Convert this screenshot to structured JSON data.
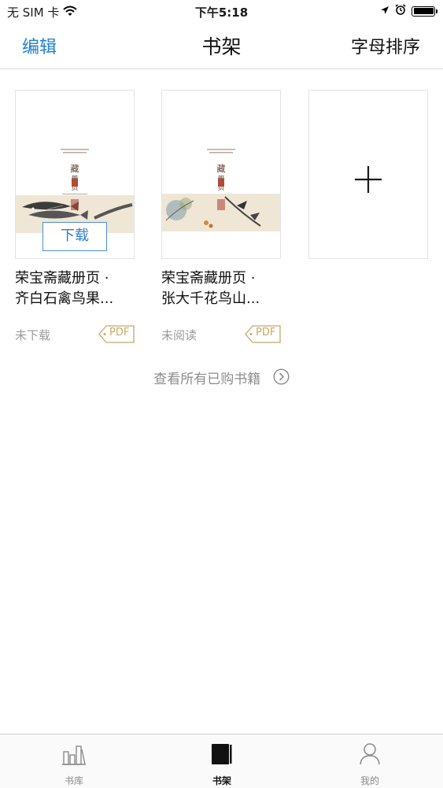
{
  "status_bar": {
    "carrier": "无 SIM 卡",
    "time": "下午5:18"
  },
  "nav": {
    "left_label": "编辑",
    "title": "书架",
    "right_label": "字母排序",
    "accent_color": "#1e7fd0"
  },
  "books": [
    {
      "title_line1": "荣宝斋藏册页 ·",
      "title_line2": "齐白石禽鸟果...",
      "status": "未下载",
      "badge": "PDF",
      "download_label": "下载"
    },
    {
      "title_line1": "荣宝斋藏册页 ·",
      "title_line2": "张大千花鸟山...",
      "status": "未阅读",
      "badge": "PDF"
    }
  ],
  "add_card": {
    "icon": "plus-icon"
  },
  "view_all": {
    "label": "查看所有已购书籍",
    "icon": "chevron-right-circle-icon"
  },
  "tabs": [
    {
      "label": "书库",
      "icon": "library-icon",
      "active": false
    },
    {
      "label": "书架",
      "icon": "bookshelf-icon",
      "active": true
    },
    {
      "label": "我的",
      "icon": "profile-icon",
      "active": false
    }
  ]
}
